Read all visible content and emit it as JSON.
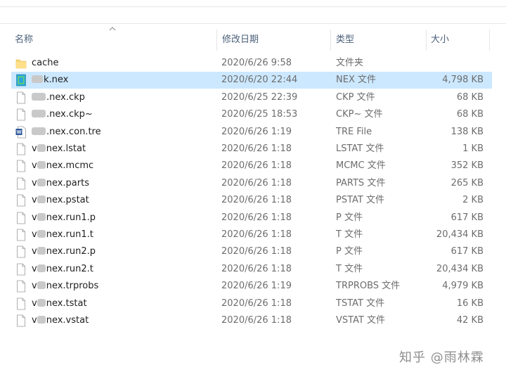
{
  "columns": {
    "name": "名称",
    "date": "修改日期",
    "type": "类型",
    "size": "大小"
  },
  "files": [
    {
      "prefix": "",
      "name": "cache",
      "date": "2020/6/26 9:58",
      "type": "文件夹",
      "size": "",
      "icon": "folder-icon",
      "selected": false,
      "blur_width": 0
    },
    {
      "prefix": "",
      "name": "k.nex",
      "date": "2020/6/20 22:44",
      "type": "NEX 文件",
      "size": "4,798 KB",
      "icon": "nex-file-icon",
      "selected": true,
      "blur_width": 16
    },
    {
      "prefix": "",
      "name": ".nex.ckp",
      "date": "2020/6/25 22:39",
      "type": "CKP 文件",
      "size": "68 KB",
      "icon": "file-icon",
      "selected": false,
      "blur_width": 20
    },
    {
      "prefix": "",
      "name": ".nex.ckp~",
      "date": "2020/6/25 18:53",
      "type": "CKP~ 文件",
      "size": "68 KB",
      "icon": "file-icon",
      "selected": false,
      "blur_width": 20
    },
    {
      "prefix": "",
      "name": ".nex.con.tre",
      "date": "2020/6/26 1:19",
      "type": "TRE File",
      "size": "138 KB",
      "icon": "word-file-icon",
      "selected": false,
      "blur_width": 20
    },
    {
      "prefix": "v",
      "name": "nex.lstat",
      "date": "2020/6/26 1:18",
      "type": "LSTAT 文件",
      "size": "1 KB",
      "icon": "file-icon",
      "selected": false,
      "blur_width": 12
    },
    {
      "prefix": "v",
      "name": "nex.mcmc",
      "date": "2020/6/26 1:18",
      "type": "MCMC 文件",
      "size": "352 KB",
      "icon": "file-icon",
      "selected": false,
      "blur_width": 12
    },
    {
      "prefix": "v",
      "name": "nex.parts",
      "date": "2020/6/26 1:18",
      "type": "PARTS 文件",
      "size": "265 KB",
      "icon": "file-icon",
      "selected": false,
      "blur_width": 12
    },
    {
      "prefix": "v",
      "name": "nex.pstat",
      "date": "2020/6/26 1:18",
      "type": "PSTAT 文件",
      "size": "2 KB",
      "icon": "file-icon",
      "selected": false,
      "blur_width": 12
    },
    {
      "prefix": "v",
      "name": "nex.run1.p",
      "date": "2020/6/26 1:18",
      "type": "P 文件",
      "size": "617 KB",
      "icon": "file-icon",
      "selected": false,
      "blur_width": 12
    },
    {
      "prefix": "v",
      "name": "nex.run1.t",
      "date": "2020/6/26 1:18",
      "type": "T 文件",
      "size": "20,434 KB",
      "icon": "file-icon",
      "selected": false,
      "blur_width": 12
    },
    {
      "prefix": "v",
      "name": "nex.run2.p",
      "date": "2020/6/26 1:18",
      "type": "P 文件",
      "size": "617 KB",
      "icon": "file-icon",
      "selected": false,
      "blur_width": 12
    },
    {
      "prefix": "v",
      "name": "nex.run2.t",
      "date": "2020/6/26 1:18",
      "type": "T 文件",
      "size": "20,434 KB",
      "icon": "file-icon",
      "selected": false,
      "blur_width": 12
    },
    {
      "prefix": "v",
      "name": "nex.trprobs",
      "date": "2020/6/26 1:19",
      "type": "TRPROBS 文件",
      "size": "4,979 KB",
      "icon": "file-icon",
      "selected": false,
      "blur_width": 12
    },
    {
      "prefix": "v",
      "name": "nex.tstat",
      "date": "2020/6/26 1:18",
      "type": "TSTAT 文件",
      "size": "16 KB",
      "icon": "file-icon",
      "selected": false,
      "blur_width": 12
    },
    {
      "prefix": "v",
      "name": "nex.vstat",
      "date": "2020/6/26 1:18",
      "type": "VSTAT 文件",
      "size": "42 KB",
      "icon": "file-icon",
      "selected": false,
      "blur_width": 12
    }
  ],
  "watermark": "知乎 @雨林霖",
  "colors": {
    "selected_bg": "#cce8ff",
    "folder": "#f8d775",
    "header_text": "#4c607a"
  }
}
